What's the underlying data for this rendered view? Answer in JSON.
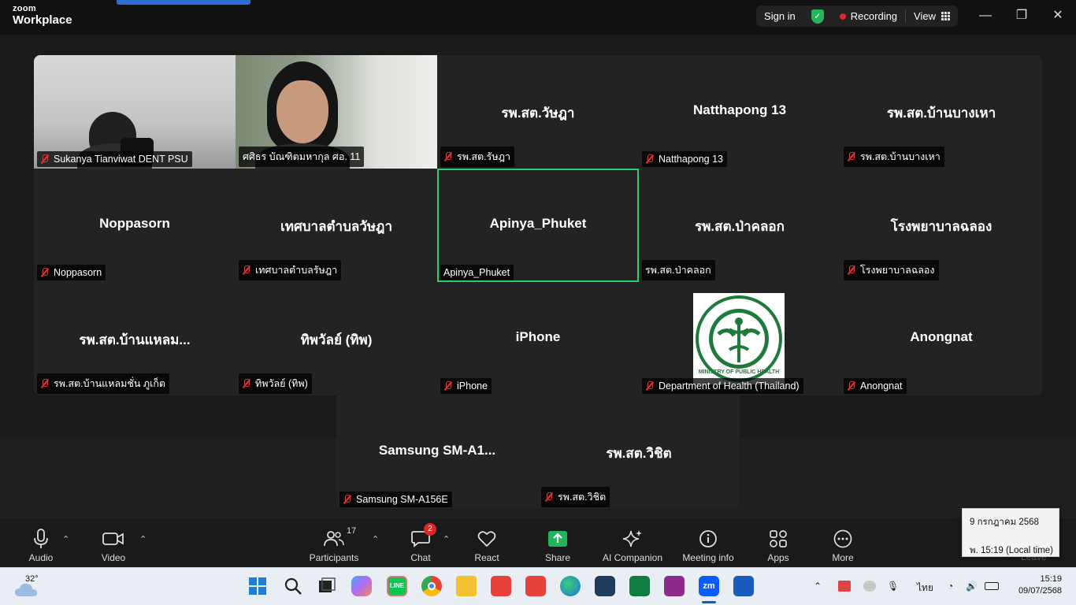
{
  "app": {
    "logo_top": "zoom",
    "logo_bottom": "Workplace"
  },
  "header": {
    "sign_in": "Sign in",
    "recording": "Recording",
    "view": "View"
  },
  "window_controls": {
    "minimize": "—",
    "restore": "❐",
    "close": "✕"
  },
  "tiles": [
    {
      "big": "",
      "name": "Sukanya Tianviwat DENT PSU",
      "muted": true,
      "video": "cam1"
    },
    {
      "big": "",
      "name": "ศศิธร บัณฑิตมหากุล ศอ. 11",
      "muted": false,
      "video": "cam2"
    },
    {
      "big": "รพ.สต.วัษฎา",
      "name": "รพ.สต.รัษฎา",
      "muted": true
    },
    {
      "big": "Natthapong 13",
      "name": "Natthapong 13",
      "muted": true
    },
    {
      "big": "รพ.สต.บ้านบางเหา",
      "name": "รพ.สต.บ้านบางเหา",
      "muted": true
    },
    {
      "big": "Noppasorn",
      "name": "Noppasorn",
      "muted": true
    },
    {
      "big": "เทศบาลตำบลวัษฎา",
      "name": "เทศบาลตำบลรัษฎา",
      "muted": true
    },
    {
      "big": "Apinya_Phuket",
      "name": "Apinya_Phuket",
      "muted": false,
      "active": true
    },
    {
      "big": "รพ.สต.ป่าคลอก",
      "name": "รพ.สต.ป่าคลอก",
      "muted": false
    },
    {
      "big": "โรงพยาบาลฉลอง",
      "name": "โรงพยาบาลฉลอง",
      "muted": true
    },
    {
      "big": "รพ.สต.บ้านแหลม...",
      "name": "รพ.สต.บ้านแหลมชั่น ภูเก็ต",
      "muted": true
    },
    {
      "big": "ทิพวัลย์ (ทิพ)",
      "name": "ทิพวัลย์ (ทิพ)",
      "muted": true
    },
    {
      "big": "iPhone",
      "name": "iPhone",
      "muted": true
    },
    {
      "big": "",
      "name": "Department of Health (Thailand)",
      "muted": true,
      "logo": "MINISTRY OF PUBLIC HEALTH"
    },
    {
      "big": "Anongnat",
      "name": "Anongnat",
      "muted": true
    },
    {
      "big": "Samsung  SM-A1...",
      "name": "Samsung SM-A156E",
      "muted": true
    },
    {
      "big": "รพ.สต.วิชิต",
      "name": "รพ.สต.วิชิต",
      "muted": true
    }
  ],
  "toolbar": {
    "audio": "Audio",
    "video": "Video",
    "participants": "Participants",
    "participants_count": "17",
    "chat": "Chat",
    "chat_badge": "2",
    "react": "React",
    "share": "Share",
    "ai": "AI Companion",
    "meeting_info": "Meeting info",
    "apps": "Apps",
    "more": "More",
    "leave": "Leave"
  },
  "tooltip": {
    "date": "9 กรกฎาคม 2568",
    "time": "พ. 15:19 (Local time)"
  },
  "taskbar": {
    "temp": "32°",
    "lang": "ไทย",
    "clock": "15:19",
    "date": "09/07/2568"
  },
  "colors": {
    "accent_green": "#2ecc71",
    "record_red": "#e02828",
    "share_green": "#22b55a"
  }
}
